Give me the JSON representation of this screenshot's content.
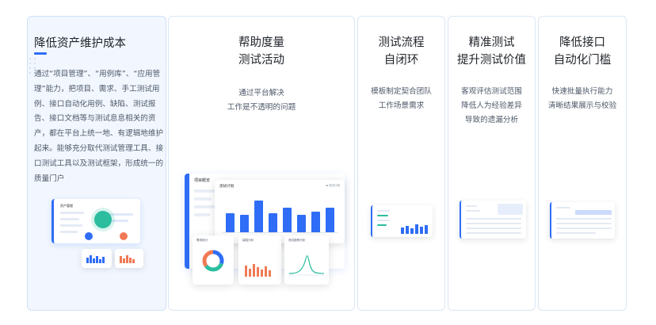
{
  "cards": [
    {
      "title": "降低资产维护成本",
      "desc": "通过“项目管理”、“用例库”、“应用管理”能力，把项目、需求、手工测试用例、接口自动化用例、缺陷、测试报告、接口文档等与测试息息相关的资产，都在平台上统一地、有逻辑地维护起来。能够充分取代测试管理工具、接口测试工具以及测试框架，形成统一的质量门户",
      "illustration": {
        "panel_label": "资产管理"
      }
    },
    {
      "title_line1": "帮助度量",
      "title_line2": "测试活动",
      "desc_line1": "通过平台解决",
      "desc_line2": "工作是不透明的问题",
      "illustration": {
        "overview_label": "项目概览",
        "chart_title": "测试计划",
        "chart_tag": "▪ 测试计划",
        "chart_values": [
          0.55,
          0.5,
          0.92,
          0.55,
          0.7,
          0.5,
          0.6,
          0.7
        ],
        "panel_a_label": "需求统计",
        "panel_b_label": "缺陷分析",
        "panel_c_label": "测试趋势分析"
      }
    },
    {
      "title_line1": "测试流程",
      "title_line2": "自闭环",
      "desc_line1": "模板制定契合团队",
      "desc_line2": "工作场景需求"
    },
    {
      "title_line1": "精准测试",
      "title_line2": "提升测试价值",
      "desc_line1": "客观评估测试范围",
      "desc_line2": "降低人为经验差异",
      "desc_line3": "导致的遗漏分析"
    },
    {
      "title_line1": "降低接口",
      "title_line2": "自动化门槛",
      "desc_line1": "快速批量执行能力",
      "desc_line2": "清晰结果展示与校验"
    }
  ],
  "colors": {
    "accent": "#2f6df6",
    "active_bg": "#f2f7ff",
    "orange": "#f07a55",
    "teal": "#2bbd9e"
  }
}
